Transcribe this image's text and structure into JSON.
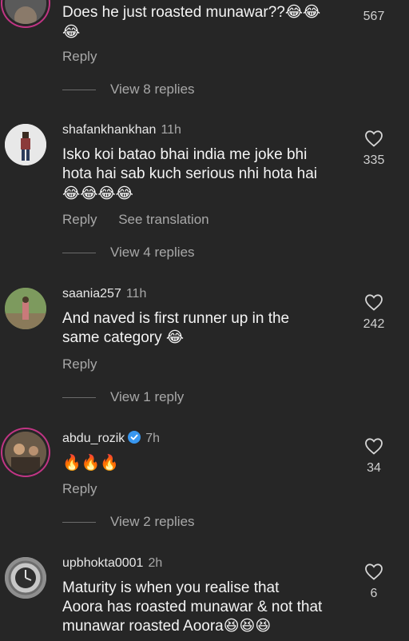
{
  "comments": [
    {
      "username": "",
      "time": "",
      "text": "Does he just roasted munawar??😂😂",
      "text2": "😂",
      "reply_label": "Reply",
      "likes": "567",
      "view_replies": "View 8 replies"
    },
    {
      "username": "shafankhankhan",
      "time": "11h",
      "text": "Isko koi batao bhai india me joke bhi",
      "text2": "hota hai sab kuch serious nhi hota hai",
      "text3": "😂😂😂😂",
      "reply_label": "Reply",
      "translation_label": "See translation",
      "likes": "335",
      "view_replies": "View 4 replies"
    },
    {
      "username": "saania257",
      "time": "11h",
      "text": "And naved is first runner up in the",
      "text2": "same category 😂",
      "reply_label": "Reply",
      "likes": "242",
      "view_replies": "View 1 reply"
    },
    {
      "username": "abdu_rozik",
      "time": "7h",
      "text": "🔥🔥🔥",
      "reply_label": "Reply",
      "likes": "34",
      "view_replies": "View 2 replies",
      "verified": true
    },
    {
      "username": "upbhokta0001",
      "time": "2h",
      "text": "Maturity is when you realise that",
      "text2": "Aoora has roasted munawar & not that",
      "text3": "munawar roasted Aoora😆😆😆",
      "likes": "6"
    }
  ],
  "icons": {
    "heart": "heart-icon",
    "verified": "verified-badge-icon"
  },
  "colors": {
    "background": "#262626",
    "verified": "#3897f0",
    "story_ring": "#c13584"
  }
}
